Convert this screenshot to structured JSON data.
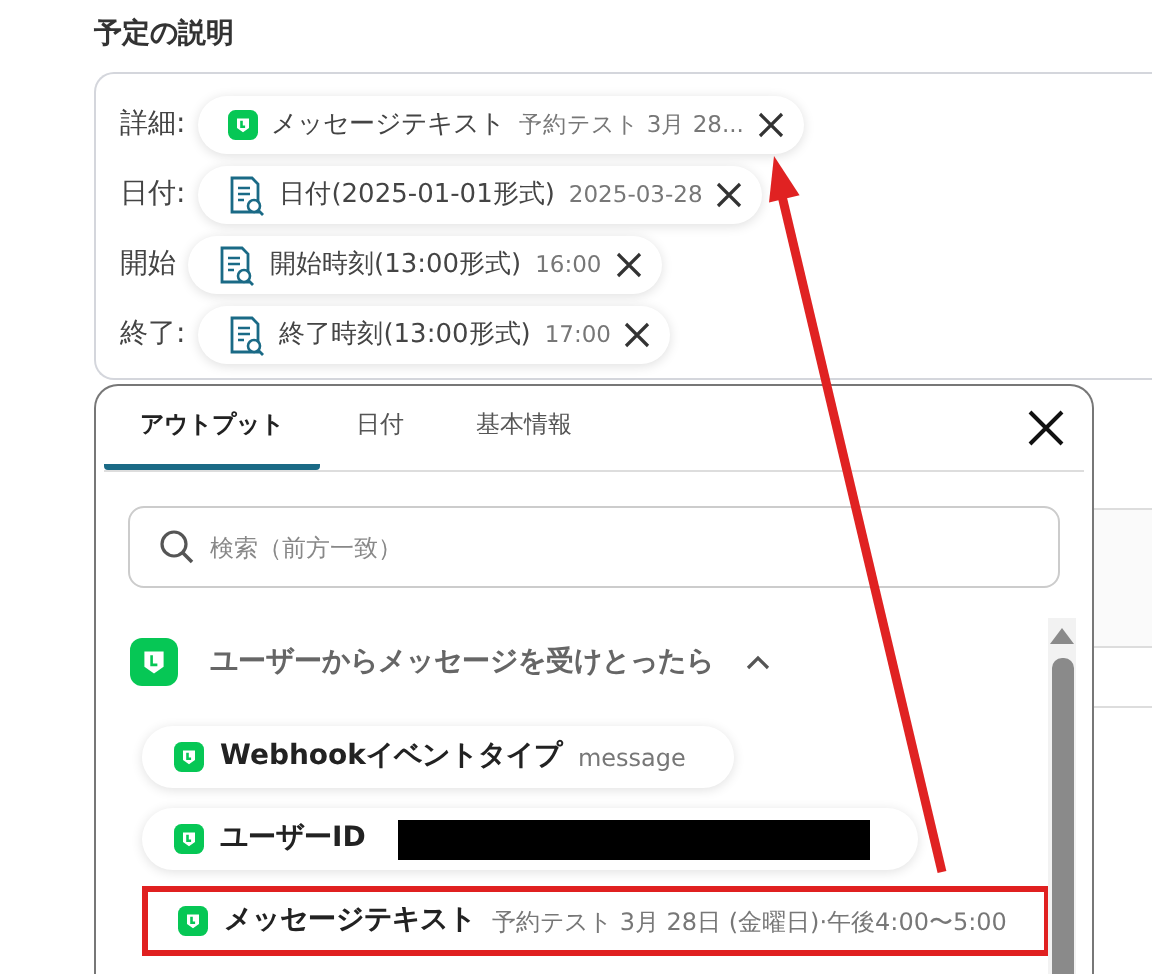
{
  "section_title": "予定の説明",
  "fields": [
    {
      "label": "詳細:",
      "token": {
        "kind": "line",
        "name": "メッセージテキスト",
        "value": "予約テスト 3月 28..."
      }
    },
    {
      "label": "日付:",
      "token": {
        "kind": "doc",
        "name": "日付(2025-01-01形式)",
        "value": "2025-03-28"
      }
    },
    {
      "label": "開始",
      "token": {
        "kind": "doc",
        "name": "開始時刻(13:00形式)",
        "value": "16:00"
      }
    },
    {
      "label": "終了:",
      "token": {
        "kind": "doc",
        "name": "終了時刻(13:00形式)",
        "value": "17:00"
      }
    }
  ],
  "popup": {
    "tabs": [
      {
        "label": "アウトプット",
        "selected": true
      },
      {
        "label": "日付",
        "selected": false
      },
      {
        "label": "基本情報",
        "selected": false
      }
    ],
    "search": {
      "placeholder": "検索（前方一致）"
    },
    "group": {
      "title": "ユーザーからメッセージを受けとったら",
      "expanded": true,
      "items": [
        {
          "name": "Webhookイベントタイプ",
          "value": "message",
          "redacted": false,
          "highlighted": false
        },
        {
          "name": "ユーザーID",
          "redacted": true,
          "highlighted": false
        },
        {
          "name": "メッセージテキスト",
          "value": "予約テスト 3月 28日 (金曜日)·午後4:00〜5:00",
          "redacted": false,
          "highlighted": true
        }
      ]
    }
  }
}
